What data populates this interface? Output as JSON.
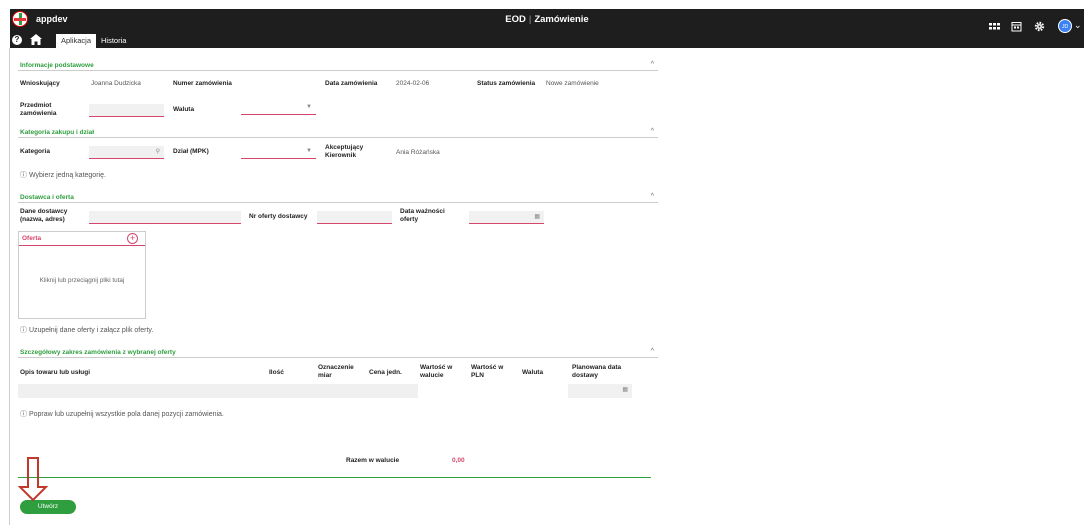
{
  "topbar": {
    "app_name": "appdev",
    "title_left": "EOD",
    "title_sep": "|",
    "title_right": "Zamówienie",
    "tabs": [
      {
        "label": "Aplikacja"
      },
      {
        "label": "Historia"
      }
    ],
    "avatar_initials": "JD",
    "icons": [
      "help-icon",
      "home-icon",
      "grid-icon",
      "calendar-icon",
      "gear-icon",
      "chevron-down-icon"
    ]
  },
  "sec1": {
    "title": "Informacje podstawowe",
    "wnioskujacy_label": "Wnioskujący",
    "wnioskujacy_value": "Joanna Dudzicka",
    "numer_label": "Numer zamówienia",
    "data_label": "Data zamówienia",
    "data_value": "2024-02-06",
    "status_label": "Status zamówienia",
    "status_value": "Nowe zamówienie",
    "przedmiot_label_1": "Przedmiot",
    "przedmiot_label_2": "zamówienia",
    "waluta_label": "Waluta"
  },
  "sec2": {
    "title": "Kategoria zakupu i dział",
    "kategoria_label": "Kategoria",
    "dzial_label": "Dział (MPK)",
    "akcept_label_1": "Akceptujący",
    "akcept_label_2": "Kierownik",
    "akcept_value": "Ania Różańska",
    "note": "ⓘ Wybierz jedną kategorię."
  },
  "sec3": {
    "title": "Dostawca i oferta",
    "dane_label_1": "Dane dostawcy",
    "dane_label_2": "(nazwa, adres)",
    "nr_oferty_label": "Nr oferty dostawcy",
    "waznosc_label_1": "Data ważności",
    "waznosc_label_2": "oferty",
    "oferta_title": "Oferta",
    "drop_text": "Kliknij lub przeciągnij pliki tutaj",
    "note": "ⓘ Uzupełnij dane oferty i załącz plik oferty."
  },
  "sec4": {
    "title": "Szczegółowy zakres zamówienia z wybranej oferty",
    "columns": [
      {
        "l1": "Opis towaru lub usługi",
        "l2": ""
      },
      {
        "l1": "Ilość",
        "l2": ""
      },
      {
        "l1": "Oznaczenie",
        "l2": "miar"
      },
      {
        "l1": "Cena jedn.",
        "l2": ""
      },
      {
        "l1": "Wartość w",
        "l2": "walucie"
      },
      {
        "l1": "Wartość w",
        "l2": "PLN"
      },
      {
        "l1": "Waluta",
        "l2": ""
      },
      {
        "l1": "Planowana data",
        "l2": "dostawy"
      }
    ],
    "note": "ⓘ Popraw lub uzupełnij wszystkie pola danej pozycji zamówienia.",
    "razem_label": "Razem w walucie",
    "razem_value": "0,00"
  },
  "actions": {
    "create_label": "Utwórz"
  },
  "colors": {
    "accent": "#2e9e3e",
    "error": "#d6456c",
    "topbar": "#1e1e1e",
    "arrow": "#c0392b"
  }
}
